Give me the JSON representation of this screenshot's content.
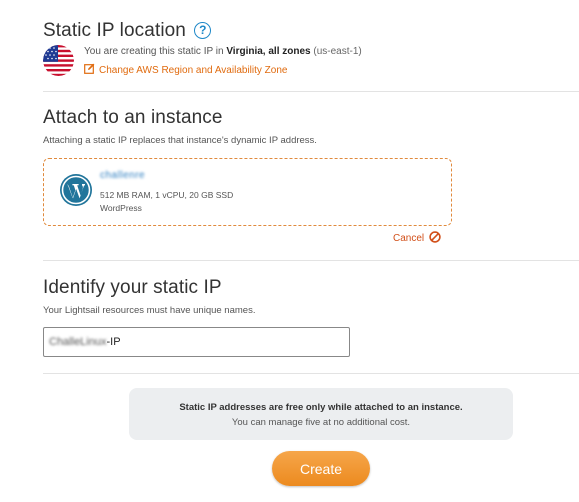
{
  "location": {
    "title": "Static IP location",
    "help_icon_glyph": "?",
    "flag_icon": "us-flag-icon",
    "creating_prefix": "You are creating this static IP in ",
    "region_name": "Virginia, all zones",
    "region_code": "(us-east-1)",
    "change_link": "Change AWS Region and Availability Zone"
  },
  "attach": {
    "title": "Attach to an instance",
    "description": "Attaching a static IP replaces that instance's dynamic IP address.",
    "instance": {
      "name": "challenre",
      "specs": "512 MB RAM, 1 vCPU, 20 GB SSD",
      "blueprint": "WordPress"
    },
    "cancel_label": "Cancel"
  },
  "identify": {
    "title": "Identify your static IP",
    "description": "Your Lightsail resources must have unique names.",
    "input_value_blurred": "ChalleLinux",
    "input_value_suffix": "-IP"
  },
  "info": {
    "strong_text": "Static IP addresses are free only while attached to an instance.",
    "sub_text": "You can manage five at no additional cost."
  },
  "create_label": "Create",
  "colors": {
    "accent_orange": "#ec8a1f",
    "link_orange": "#e06b0f",
    "help_blue": "#1e88c8",
    "cancel_red": "#d2501a"
  }
}
